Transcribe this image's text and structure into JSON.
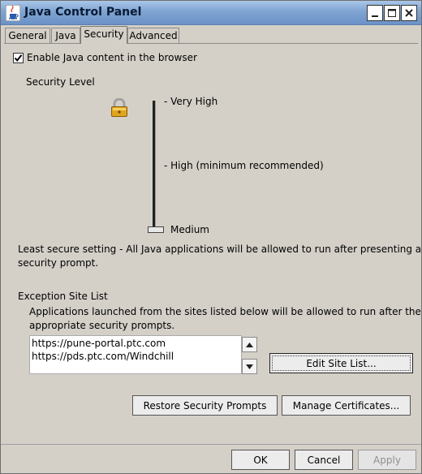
{
  "window": {
    "title": "Java Control Panel",
    "icon": "java-cup-icon",
    "controls": {
      "minimize": "minimize-icon",
      "maximize": "maximize-icon",
      "close": "close-icon"
    }
  },
  "tabs": [
    {
      "label": "General",
      "active": false
    },
    {
      "label": "Java",
      "active": false
    },
    {
      "label": "Security",
      "active": true
    },
    {
      "label": "Advanced",
      "active": false
    }
  ],
  "security": {
    "enable_checkbox": {
      "label": "Enable Java content in the browser",
      "checked": true
    },
    "level_heading": "Security Level",
    "lock_icon": "padlock-icon",
    "levels": [
      "- Very High",
      "- High (minimum recommended)",
      "Medium"
    ],
    "selected_level": "Medium",
    "description_line1": "Least secure setting - All Java applications will be allowed to run after presenting a",
    "description_line2": "security prompt."
  },
  "exception_list": {
    "heading": "Exception Site List",
    "info_line1": "Applications launched from the sites listed below will be allowed to run after the",
    "info_line2": "appropriate security prompts.",
    "sites": [
      "https://pune-portal.ptc.com",
      "https://pds.ptc.com/Windchill"
    ],
    "edit_button": "Edit Site List..."
  },
  "actions": {
    "restore_button": "Restore Security Prompts",
    "certificates_button": "Manage Certificates..."
  },
  "footer": {
    "ok": "OK",
    "cancel": "Cancel",
    "apply": "Apply"
  },
  "colors": {
    "dialog_bg": "#d4d0c8",
    "title_bar": "#7fa4d2"
  }
}
